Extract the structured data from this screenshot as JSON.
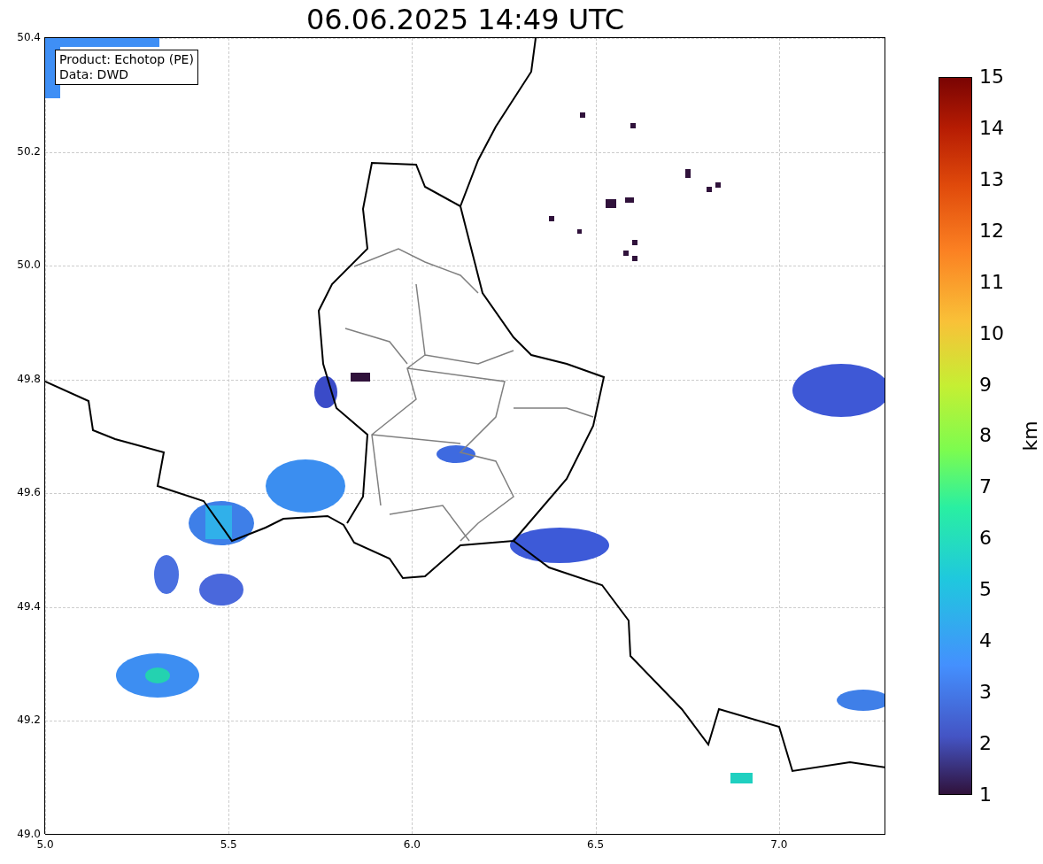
{
  "title": "06.06.2025 14:49 UTC",
  "legend": {
    "lines": [
      "Product: Echotop (PE)",
      "Data: DWD"
    ]
  },
  "x_axis": {
    "ticks": [
      "5.0",
      "5.5",
      "6.0",
      "6.5",
      "7.0"
    ]
  },
  "y_axis": {
    "ticks": [
      "50.4",
      "50.2",
      "50.0",
      "49.8",
      "49.6",
      "49.4",
      "49.2",
      "49.0"
    ]
  },
  "colorbar": {
    "label": "km",
    "ticks": [
      "15",
      "14",
      "13",
      "12",
      "11",
      "10",
      "9",
      "8",
      "7",
      "6",
      "5",
      "4",
      "3",
      "2",
      "1"
    ]
  }
}
